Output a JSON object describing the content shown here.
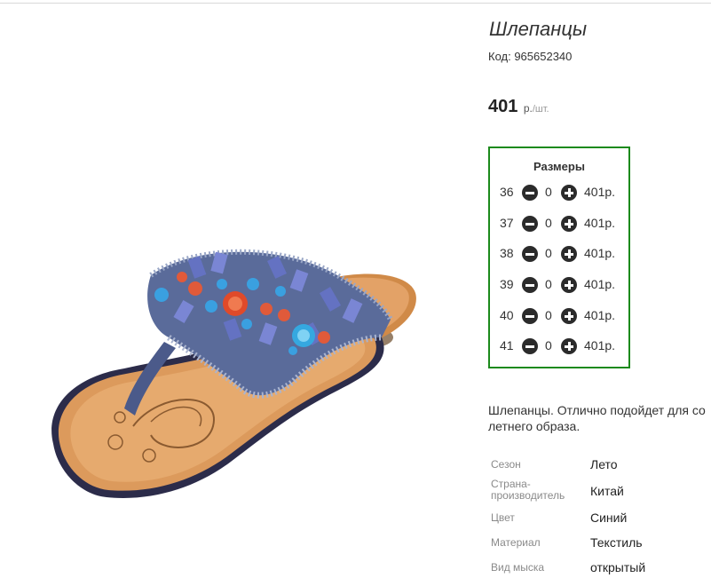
{
  "product": {
    "title": "Шлепанцы",
    "code": "Код: 965652340",
    "price_value": "401",
    "price_currency": "р.",
    "price_per": "/шт.",
    "image_icon": "flip-flop-sandal-image"
  },
  "sizes": {
    "title": "Размеры",
    "rows": [
      {
        "size": "36",
        "qty": "0",
        "price": "401р."
      },
      {
        "size": "37",
        "qty": "0",
        "price": "401р."
      },
      {
        "size": "38",
        "qty": "0",
        "price": "401р."
      },
      {
        "size": "39",
        "qty": "0",
        "price": "401р."
      },
      {
        "size": "40",
        "qty": "0",
        "price": "401р."
      },
      {
        "size": "41",
        "qty": "0",
        "price": "401р."
      }
    ],
    "border_color": "#1c8a1c"
  },
  "description": "Шлепанцы. Отлично подойдет для со летнего образа.",
  "specs": [
    {
      "key": "Сезон",
      "value": "Лето"
    },
    {
      "key": "Страна-производитель",
      "value": "Китай"
    },
    {
      "key": "Цвет",
      "value": "Синий"
    },
    {
      "key": "Материал",
      "value": "Текстиль"
    },
    {
      "key": "Вид мыска",
      "value": "открытый"
    }
  ]
}
